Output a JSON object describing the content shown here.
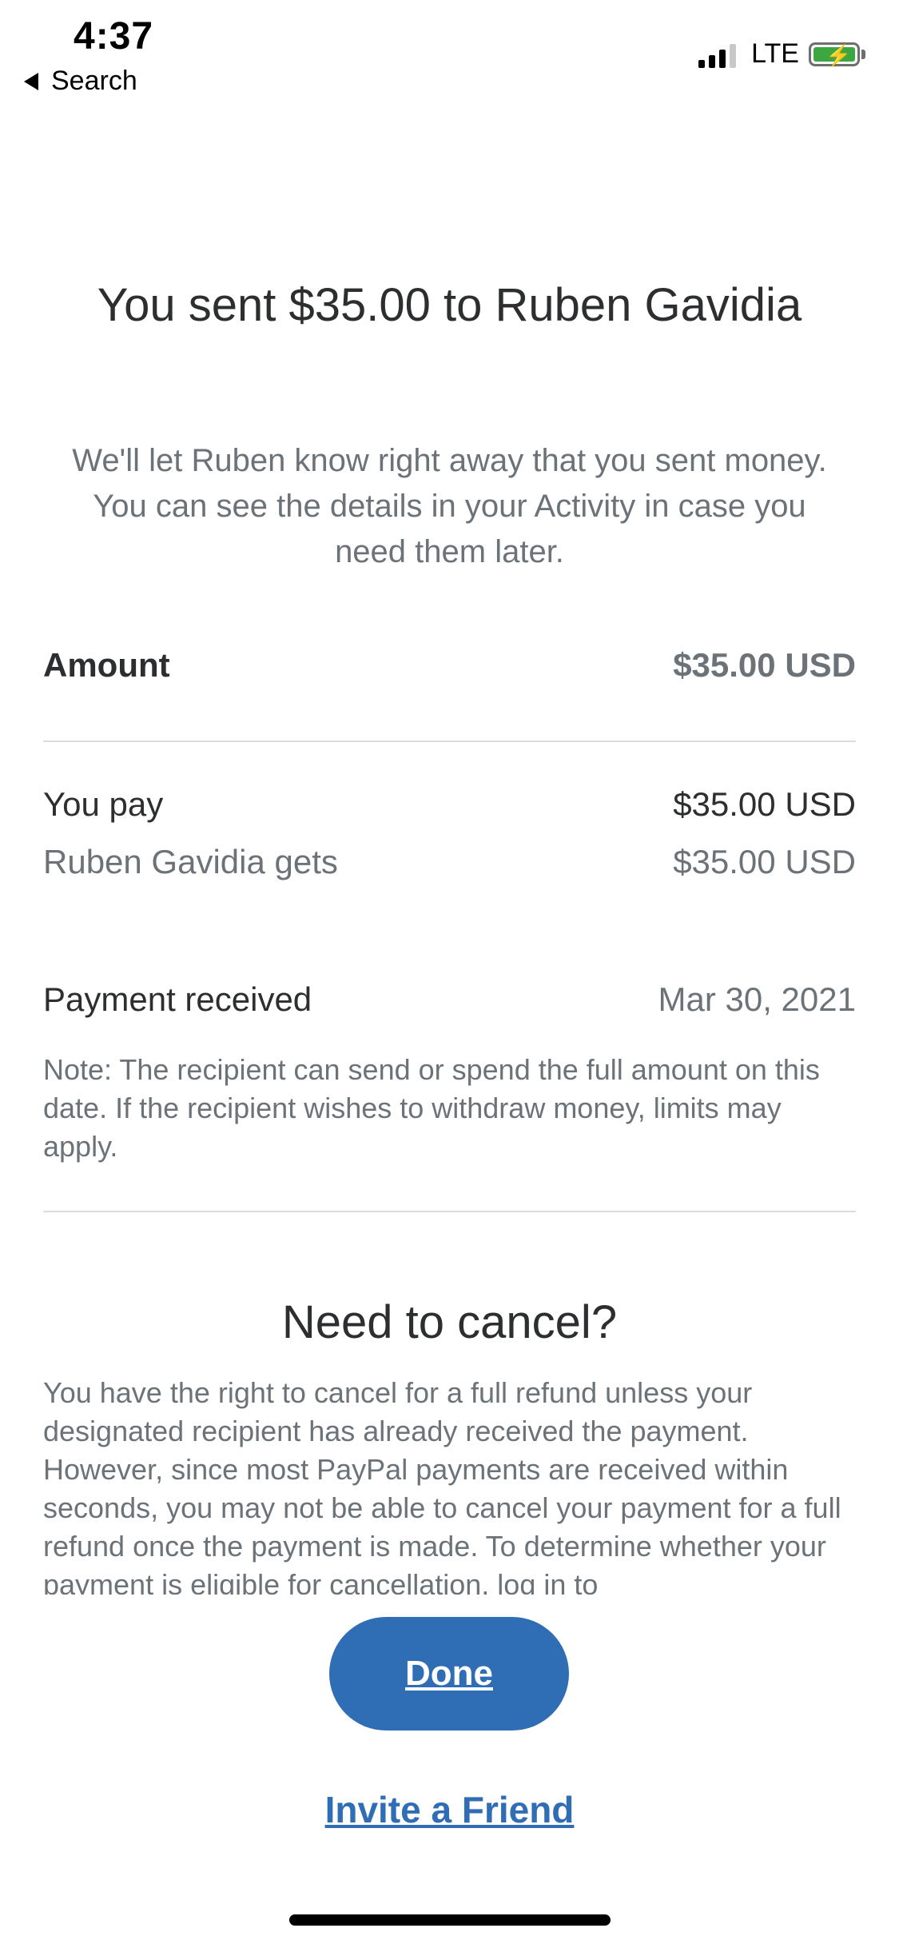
{
  "status_bar": {
    "time": "4:37",
    "back_label": "Search",
    "network": "LTE"
  },
  "header": {
    "title": "You sent $35.00 to Ruben Gavidia"
  },
  "intro": "We'll let Ruben know right away that you sent money. You can see the details in your Activity in case you need them later.",
  "details": {
    "amount_label": "Amount",
    "amount_value": "$35.00 USD",
    "you_pay_label": "You pay",
    "you_pay_value": "$35.00 USD",
    "recipient_gets_label": "Ruben Gavidia gets",
    "recipient_gets_value": "$35.00 USD",
    "payment_received_label": "Payment received",
    "payment_received_value": "Mar 30, 2021",
    "note": "Note: The recipient can send or spend the full amount on this date. If the recipient wishes to withdraw money, limits may apply."
  },
  "cancel": {
    "title": "Need to cancel?",
    "text": "You have the right to cancel for a full refund unless your designated recipient has already received the payment. However, since most PayPal payments are received within seconds, you may not be able to cancel your payment for a full refund once the payment is made. To determine whether your payment is eligible for cancellation, log in to"
  },
  "actions": {
    "done_label": "Done",
    "invite_label": "Invite a Friend"
  },
  "colors": {
    "primary_blue": "#2f6db5",
    "text_dark": "#2c2e2f",
    "text_gray": "#6c7378",
    "battery_green": "#3ca741"
  }
}
